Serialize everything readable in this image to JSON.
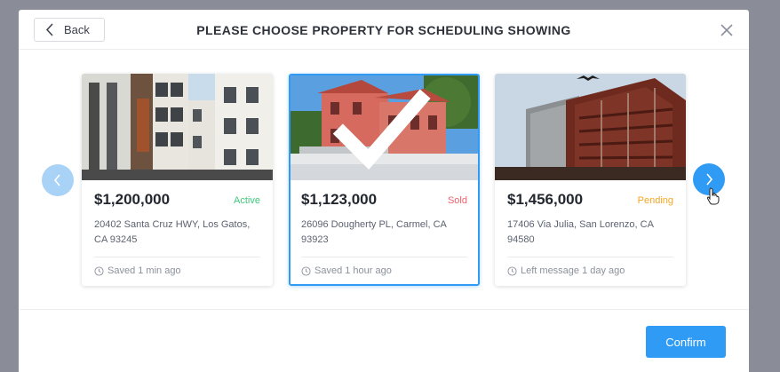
{
  "header": {
    "back_label": "Back",
    "title": "PLEASE CHOOSE PROPERTY FOR SCHEDULING SHOWING"
  },
  "footer": {
    "confirm_label": "Confirm"
  },
  "colors": {
    "accent": "#2f9bf4",
    "active": "#3fc87a",
    "sold": "#f0616a",
    "pending": "#f5a623"
  },
  "properties": [
    {
      "price": "$1,200,000",
      "status": "Active",
      "address": "20402 Santa Cruz HWY, Los Gatos, CA 93245",
      "meta": "Saved 1 min ago",
      "selected": false
    },
    {
      "price": "$1,123,000",
      "status": "Sold",
      "address": "26096 Dougherty PL, Carmel, CA 93923",
      "meta": "Saved 1 hour ago",
      "selected": true
    },
    {
      "price": "$1,456,000",
      "status": "Pending",
      "address": "17406 Via Julia, San Lorenzo, CA 94580",
      "meta": "Left message 1 day ago",
      "selected": false
    }
  ]
}
